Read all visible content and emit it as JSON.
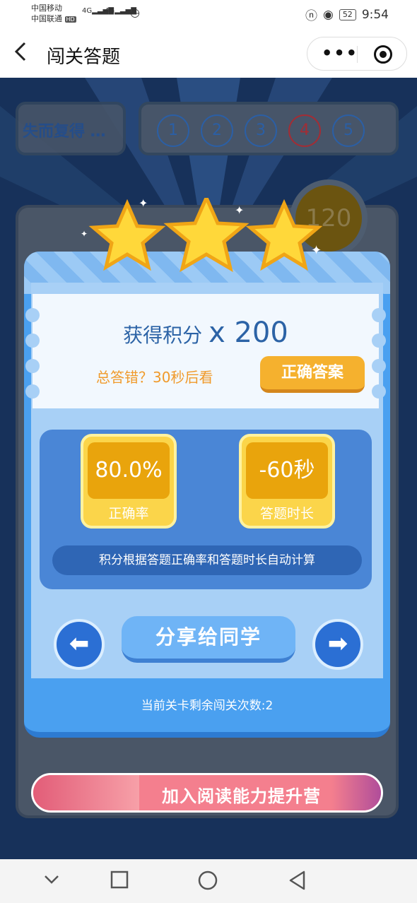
{
  "status_bar": {
    "carrier_1": "中国移动",
    "carrier_2": "中国联通",
    "hd_badge": "HD",
    "network": "4G",
    "battery": "52",
    "time": "9:54"
  },
  "nav": {
    "title": "闯关答题",
    "back_icon": "chevron-left-icon",
    "more_icon": "more-dots-icon",
    "close_icon": "target-icon"
  },
  "level_header": {
    "title": "失而复得 …",
    "levels": [
      "1",
      "2",
      "3",
      "4",
      "5"
    ],
    "current_level": "4"
  },
  "coin": {
    "value": "120"
  },
  "result": {
    "stars_earned": 3,
    "score_label": "获得积分",
    "score_value": "x 200",
    "hint": "总答错？30秒后看",
    "answer_button": "正确答案",
    "accuracy_value": "80.0%",
    "accuracy_label": "正确率",
    "duration_value": "-60秒",
    "duration_label": "答题时长",
    "formula_note": "积分根据答题正确率和答题时长自动计算",
    "share_button": "分享给同学",
    "remaining": "当前关卡剩余闯关次数:2"
  },
  "banner": {
    "text": "加入阅读能力提升营"
  },
  "colors": {
    "background": "#17315a",
    "panel": "#4aa0f0",
    "gold": "#fbd54a",
    "accent_orange": "#f09a2a",
    "banner": "#f47f8e"
  }
}
